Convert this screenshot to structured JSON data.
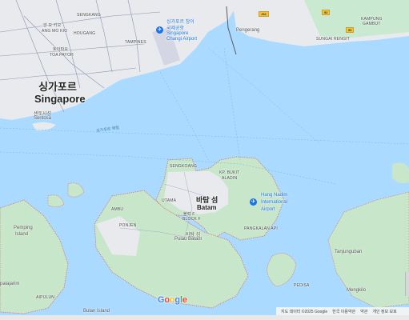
{
  "colors": {
    "water": "#aadaff",
    "land": "#e8eaed",
    "green": "#c4e8c6",
    "road": "#8a94b0",
    "shore": "#d96b6b"
  },
  "labels": {
    "sengkang": "SENGKANG",
    "ang_mo_kio": "ANG MO KIO",
    "hougang": "HOUGANG",
    "tampines": "TAMPINES",
    "toa_payoh": "TOA PAYOH",
    "ko_small_1": "앙 모 키오",
    "ko_small_2": "토아파요",
    "singapore_ko": "싱가포르",
    "singapore_en": "Singapore",
    "sentosa_ko": "센토사섬",
    "sentosa_en": "Sentosa",
    "changi_ko": "싱가포르 창이",
    "changi_ko2": "국제공항",
    "changi_en1": "Singapore",
    "changi_en2": "Changi Airport",
    "pengerang": "Pengerang",
    "kampung": "KAMPUNG",
    "gambut": "GAMBUT",
    "sungai_rengit": "SUNGAI RENGIT",
    "strait_ko": "싱가포르 해협",
    "sengkoang": "SENGKOANG",
    "kp_bukit": "KP. BUKIT",
    "aladin": "ALADIN",
    "batam_ko": "바탐 섬",
    "batam_en": "Batam",
    "hang_nadim_1": "Hang Nadim",
    "hang_nadim_2": "International",
    "hang_nadim_3": "Airport",
    "utama": "UTAMA",
    "ko_small_3": "블럭 F",
    "block_f": "BLOCK F",
    "ambu": "AMBU",
    "ponjen": "PONJEN",
    "pangkalan_api": "PANGKALAN API",
    "pulau_batam_ko": "바탐 섬",
    "pulau_batam_en": "Pulau Batam",
    "pemping_1": "Pemping",
    "pemping_2": "Island",
    "tanjunguban": "Tanjunguban",
    "mengkilo": "Mengkilo",
    "pedisa": "PEDISA",
    "palajarim": "palajarim",
    "aipulun": "AIPULUN",
    "bulan_island": "Bulan Island"
  },
  "shields": {
    "j32": "J32",
    "s92": "92",
    "s90": "90"
  },
  "google_logo": [
    "G",
    "o",
    "o",
    "g",
    "l",
    "e"
  ],
  "google_colors": [
    "#4285f4",
    "#ea4335",
    "#fbbc05",
    "#4285f4",
    "#34a853",
    "#ea4335"
  ],
  "footer": {
    "attribution": "지도 데이터 ©2025 Google",
    "terms": "한국 이용약관",
    "privacy": "약관",
    "report": "개인 정보 보호"
  }
}
